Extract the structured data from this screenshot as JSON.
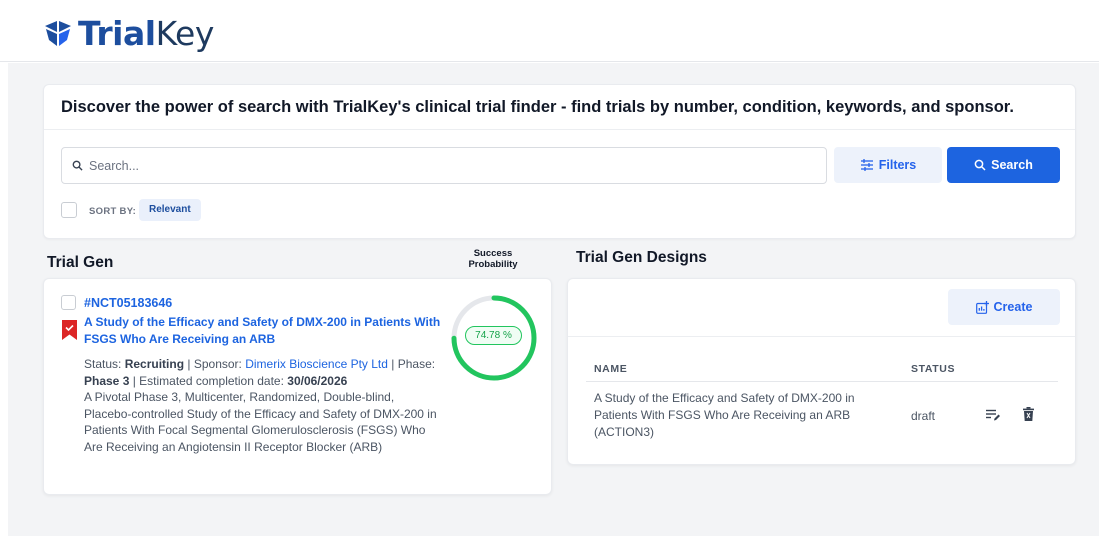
{
  "app": {
    "logo_primary": "Trial",
    "logo_secondary": "Key",
    "brand_color": "#1d4e9e",
    "accent_color": "#1d64e0"
  },
  "search_panel": {
    "headline": "Discover the power of search with TrialKey's clinical trial finder - find trials by number, condition, keywords, and sponsor.",
    "placeholder": "Search...",
    "value": "",
    "filters_label": "Filters",
    "search_label": "Search",
    "sort_label": "SORT BY:",
    "sort_value": "Relevant"
  },
  "trial_gen": {
    "title": "Trial Gen",
    "success_label_line1": "Success",
    "success_label_line2": "Probability",
    "trial": {
      "id": "#NCT05183646",
      "title": "A Study of the Efficacy and Safety of DMX-200 in Patients With FSGS Who Are Receiving an ARB",
      "status_label": "Status:",
      "status": "Recruiting",
      "sponsor_label": "Sponsor:",
      "sponsor": "Dimerix Bioscience Pty Ltd",
      "phase_label": "Phase:",
      "phase": "Phase 3",
      "completion_label": "Estimated completion date:",
      "completion_date": "30/06/2026",
      "description": "A Pivotal Phase 3, Multicenter, Randomized, Double-blind, Placebo-controlled Study of the Efficacy and Safety of DMX-200 in Patients With Focal Segmental Glomerulosclerosis (FSGS) Who Are Receiving an Angiotensin II Receptor Blocker (ARB)",
      "success_probability": 74.78,
      "success_probability_label": "74.78 %",
      "bookmarked": true,
      "gauge_color": "#22c55e"
    }
  },
  "designs": {
    "title": "Trial Gen Designs",
    "create_label": "Create",
    "columns": {
      "name": "NAME",
      "status": "STATUS"
    },
    "rows": [
      {
        "name": "A Study of the Efficacy and Safety of DMX-200 in Patients With FSGS Who Are Receiving an ARB (ACTION3)",
        "status": "draft"
      }
    ]
  }
}
